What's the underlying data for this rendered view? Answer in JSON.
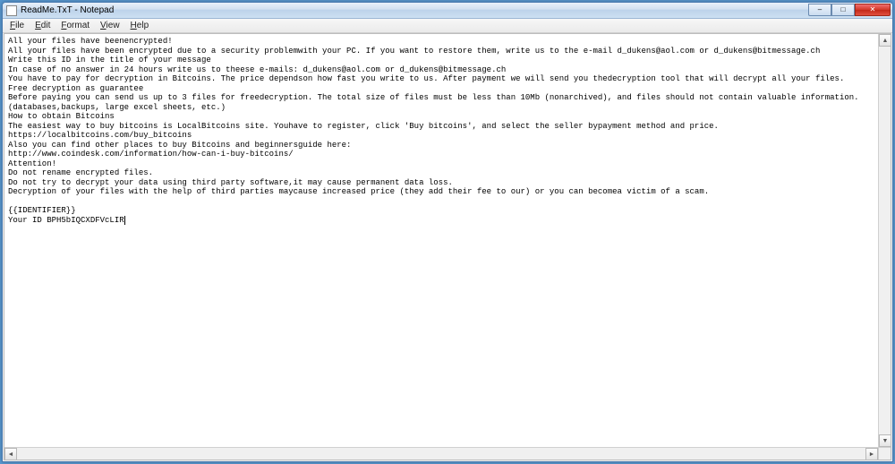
{
  "window": {
    "title": "ReadMe.TxT - Notepad"
  },
  "menu": {
    "file": "File",
    "edit": "Edit",
    "format": "Format",
    "view": "View",
    "help": "Help"
  },
  "controls": {
    "min_label": "–",
    "max_label": "□",
    "close_label": "✕"
  },
  "document": {
    "lines": [
      "All your files have beenencrypted!",
      "All your files have been encrypted due to a security problemwith your PC. If you want to restore them, write us to the e-mail d_dukens@aol.com or d_dukens@bitmessage.ch",
      "Write this ID in the title of your message",
      "In case of no answer in 24 hours write us to theese e-mails: d_dukens@aol.com or d_dukens@bitmessage.ch",
      "You have to pay for decryption in Bitcoins. The price dependson how fast you write to us. After payment we will send you thedecryption tool that will decrypt all your files.",
      "Free decryption as guarantee",
      "Before paying you can send us up to 3 files for freedecryption. The total size of files must be less than 10Mb (nonarchived), and files should not contain valuable information.",
      "(databases,backups, large excel sheets, etc.)",
      "How to obtain Bitcoins",
      "The easiest way to buy bitcoins is LocalBitcoins site. Youhave to register, click 'Buy bitcoins', and select the seller bypayment method and price.",
      "https://localbitcoins.com/buy_bitcoins",
      "Also you can find other places to buy Bitcoins and beginnersguide here:",
      "http://www.coindesk.com/information/how-can-i-buy-bitcoins/",
      "Attention!",
      "Do not rename encrypted files.",
      "Do not try to decrypt your data using third party software,it may cause permanent data loss.",
      "Decryption of your files with the help of third parties maycause increased price (they add their fee to our) or you can becomea victim of a scam.",
      "",
      "{{IDENTIFIER}}",
      "Your ID BPH5bIQCXDFVcLIR"
    ],
    "caret_line": 19
  }
}
